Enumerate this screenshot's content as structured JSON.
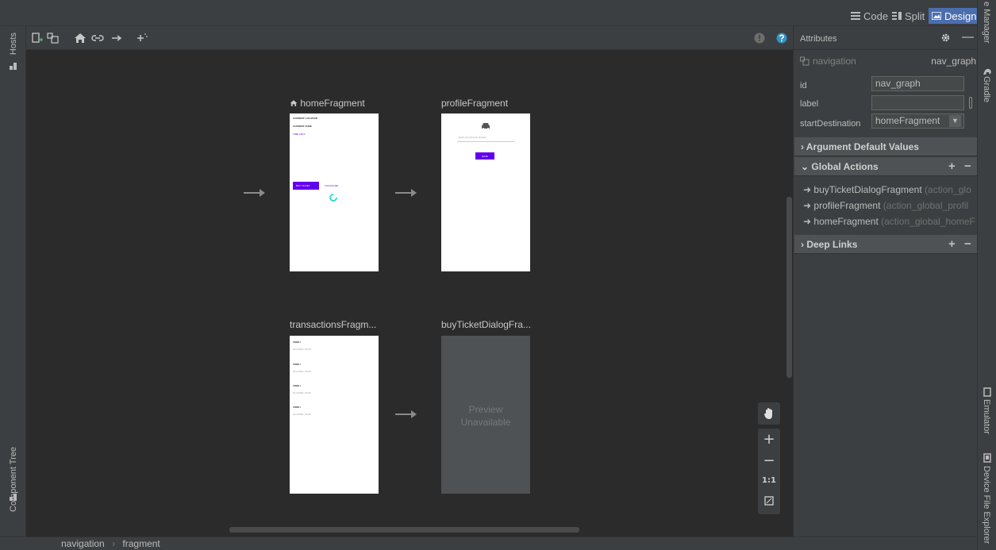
{
  "top_bar": {
    "code_label": "Code",
    "split_label": "Split",
    "design_label": "Design"
  },
  "left_strip": {
    "hosts_label": "Hosts",
    "component_tree_label": "Component Tree"
  },
  "right_strip": {
    "resource_manager_label": "e Manager",
    "gradle_label": "Gradle",
    "emulator_label": "Emulator",
    "device_file_explorer_label": "Device File Explorer"
  },
  "canvas": {
    "fragments": [
      {
        "title": "homeFragment",
        "is_start": true,
        "content": {
          "line1": "CURRENT LOCATION",
          "line2": "CURRENT ZONE",
          "line3": "TIME LEFT:",
          "button": "BUY TICKET",
          "link": "LOCATE ME"
        }
      },
      {
        "title": "profileFragment",
        "content": {
          "input_placeholder": "Enter your licence number",
          "button": "SAVE"
        }
      },
      {
        "title": "transactionsFragm...",
        "content": {
          "items": [
            {
              "zone": "ZONE I",
              "date": "22.4.2022. 16:00"
            },
            {
              "zone": "ZONE I",
              "date": "22.4.2022. 16:00"
            },
            {
              "zone": "ZONE I",
              "date": "22.4.2022. 16:00"
            },
            {
              "zone": "ZONE I",
              "date": "22.4.2022. 16:00"
            }
          ]
        }
      },
      {
        "title": "buyTicketDialogFra...",
        "preview_text_line1": "Preview",
        "preview_text_line2": "Unavailable"
      }
    ],
    "zoom_controls": {
      "zoom_in": "+",
      "zoom_out": "−",
      "one_to_one": "1:1"
    }
  },
  "attributes": {
    "panel_title": "Attributes",
    "component_type": "navigation",
    "component_id": "nav_graph",
    "fields": {
      "id_label": "id",
      "id_value": "nav_graph",
      "label_label": "label",
      "label_value": "",
      "start_destination_label": "startDestination",
      "start_destination_value": "homeFragment"
    },
    "sections": {
      "argument_default_values": "Argument Default Values",
      "global_actions": "Global Actions",
      "deep_links": "Deep Links"
    },
    "global_actions": [
      {
        "name": "buyTicketDialogFragment",
        "detail": "(action_glo"
      },
      {
        "name": "profileFragment",
        "detail": "(action_global_profil"
      },
      {
        "name": "homeFragment",
        "detail": "(action_global_homeF"
      }
    ]
  },
  "status_bar": {
    "breadcrumb": [
      "navigation",
      "fragment"
    ]
  },
  "colors": {
    "accent": "#6200ee",
    "active_tab": "#4b6eaf",
    "help_icon": "#3592c4"
  }
}
